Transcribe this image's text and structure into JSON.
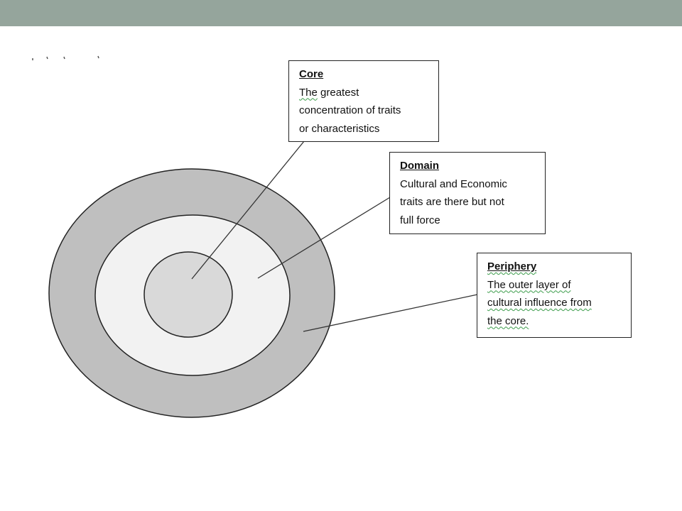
{
  "slide": {
    "header_bar_color": "#95a59c"
  },
  "diagram": {
    "type": "concentric-circles",
    "rings": [
      {
        "name": "periphery",
        "fill": "#bfbfbf"
      },
      {
        "name": "domain",
        "fill": "#f2f2f2"
      },
      {
        "name": "core",
        "fill": "#d9d9d9"
      }
    ],
    "callouts": {
      "core": {
        "heading": "Core",
        "lines": [
          "The greatest",
          "concentration of traits",
          "or characteristics"
        ]
      },
      "domain": {
        "heading": "Domain",
        "lines": [
          "Cultural and Economic",
          "traits are there but not",
          "full force"
        ]
      },
      "periphery": {
        "heading": "Periphery",
        "lines": [
          "The outer layer of",
          "cultural influence from",
          "the core."
        ]
      }
    }
  }
}
